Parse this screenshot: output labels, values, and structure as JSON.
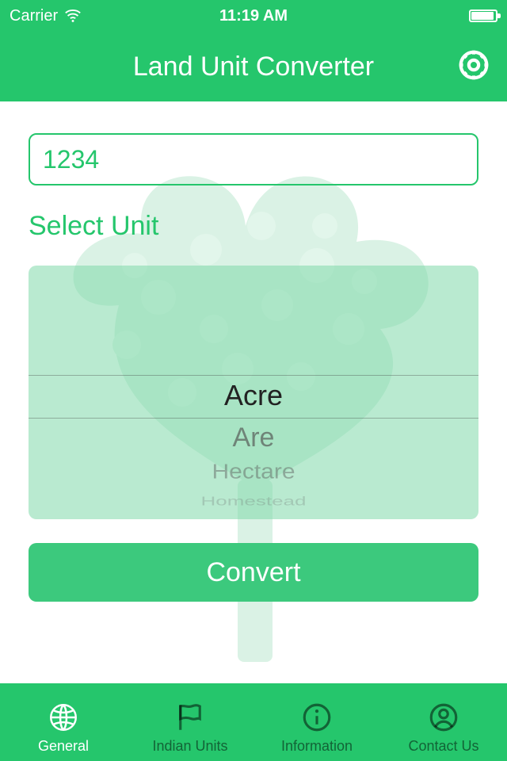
{
  "status": {
    "carrier": "Carrier",
    "time": "11:19 AM"
  },
  "header": {
    "title": "Land Unit Converter"
  },
  "input": {
    "value": "1234"
  },
  "select_label": "Select Unit",
  "picker": {
    "selected": "Acre",
    "items": [
      "Acre",
      "Are",
      "Hectare",
      "Homestead"
    ]
  },
  "convert_label": "Convert",
  "tabs": [
    {
      "label": "General",
      "icon": "globe-icon",
      "active": true
    },
    {
      "label": "Indian Units",
      "icon": "flag-icon",
      "active": false
    },
    {
      "label": "Information",
      "icon": "info-icon",
      "active": false
    },
    {
      "label": "Contact Us",
      "icon": "person-icon",
      "active": false
    }
  ],
  "colors": {
    "brand": "#25c66c"
  }
}
